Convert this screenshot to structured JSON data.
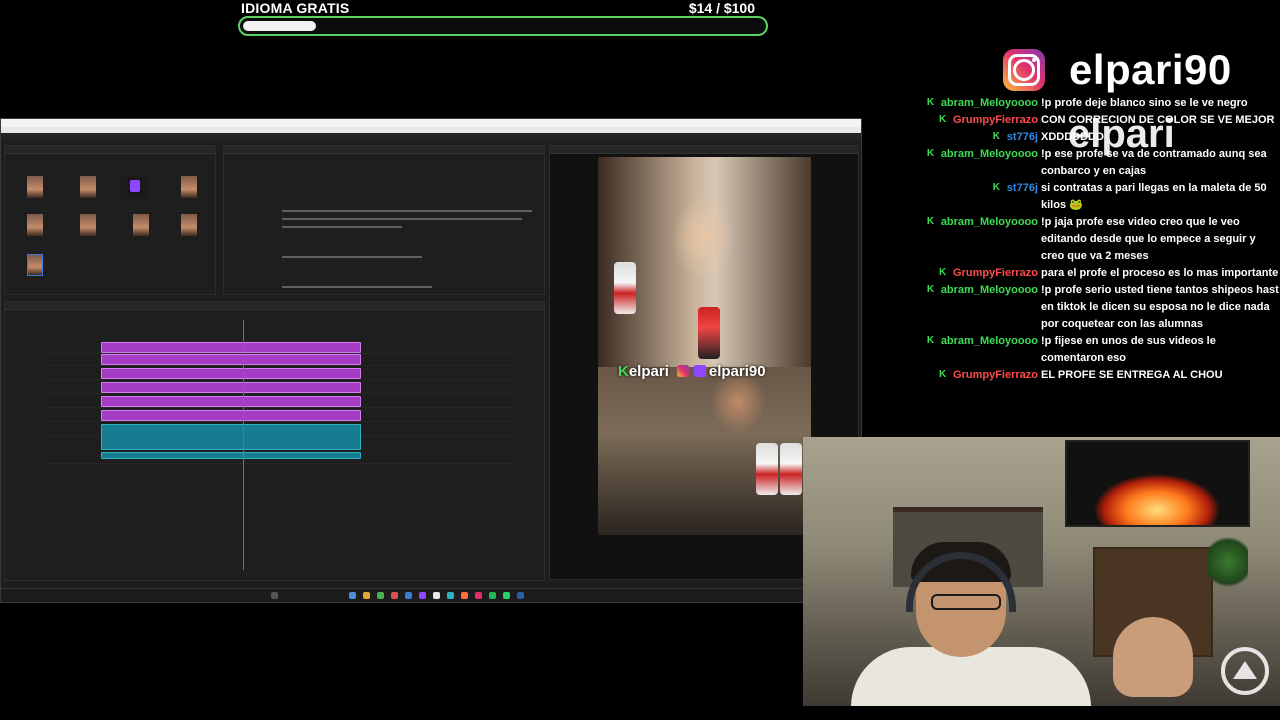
{
  "goal": {
    "title": "IDIOMA GRATIS",
    "amount": "$14  / $100",
    "progress": 0.14,
    "accent_color": "#5bd35f"
  },
  "brand": {
    "icon": "instagram-icon",
    "name": "elpari90",
    "ghost_text": "elpari"
  },
  "chat": {
    "messages": [
      {
        "user": "abram_Meloyoooo",
        "user_color": "#3ddc52",
        "text": "!p profe deje blanco sino se le ve negro"
      },
      {
        "user": "GrumpyFierrazo",
        "user_color": "#ff4b4b",
        "text": "CON CORRECION DE COLOR SE VE MEJOR"
      },
      {
        "user": "st776j",
        "user_color": "#2e8ae6",
        "text": "XDDDDDDD"
      },
      {
        "user": "abram_Meloyoooo",
        "user_color": "#3ddc52",
        "text": "!p ese profe se va de contramado aunq sea conbarco y en cajas"
      },
      {
        "user": "st776j",
        "user_color": "#2e8ae6",
        "text": "si contratas a pari llegas en la maleta de 50 kilos 🐸"
      },
      {
        "user": "abram_Meloyoooo",
        "user_color": "#3ddc52",
        "text": "!p jaja profe ese video creo que le veo editando desde que lo empece a seguir y creo que va 2 meses"
      },
      {
        "user": "GrumpyFierrazo",
        "user_color": "#ff4b4b",
        "text": "para el profe el proceso es lo mas importante"
      },
      {
        "user": "abram_Meloyoooo",
        "user_color": "#3ddc52",
        "text": "!p profe serio usted tiene tantos shipeos hast en tiktok le dicen su esposa no le dice nada por coquetear con las alumnas"
      },
      {
        "user": "abram_Meloyoooo",
        "user_color": "#3ddc52",
        "text": "!p fijese en unos de sus videos le comentaron eso"
      },
      {
        "user": "GrumpyFierrazo",
        "user_color": "#ff4b4b",
        "text": "EL PROFE SE ENTREGA AL CHOU"
      }
    ]
  },
  "video": {
    "watermark_left": "elpari",
    "watermark_right": "elpari90"
  }
}
